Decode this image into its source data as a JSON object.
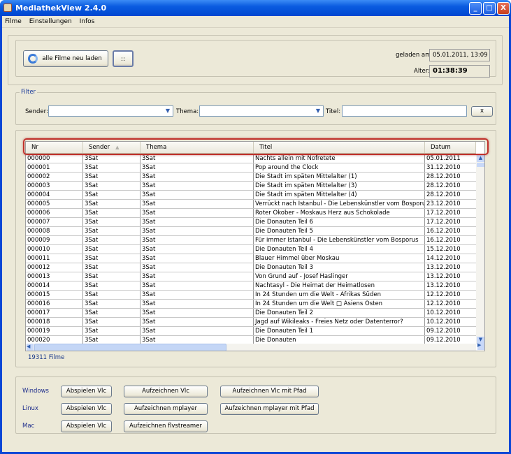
{
  "window": {
    "title": "MediathekView 2.4.0",
    "min": "_",
    "max": "□",
    "close": "X"
  },
  "menu": [
    "Filme",
    "Einstellungen",
    "Infos"
  ],
  "top": {
    "reload_label": "alle Filme neu laden",
    "extra_label": "::",
    "loaded_label": "geladen am:",
    "loaded_value": "05.01.2011, 13:09",
    "age_label": "Alter:",
    "age_value": "01:38:39"
  },
  "filter": {
    "legend": "Filter",
    "sender_label": "Sender:",
    "sender_value": "",
    "thema_label": "Thema:",
    "thema_value": "",
    "titel_label": "Titel:",
    "titel_value": "",
    "clear_label": "x"
  },
  "table": {
    "columns": [
      "Nr",
      "Sender",
      "Thema",
      "Titel",
      "Datum"
    ],
    "sort_column": "Sender",
    "sort_dir": "ascending",
    "rows": [
      [
        "000000",
        "3Sat",
        "3Sat",
        "Nachts allein mit Nofretete",
        "05.01.2011"
      ],
      [
        "000001",
        "3Sat",
        "3Sat",
        "Pop around the Clock",
        "31.12.2010"
      ],
      [
        "000002",
        "3Sat",
        "3Sat",
        "Die Stadt im späten Mittelalter (1)",
        "28.12.2010"
      ],
      [
        "000003",
        "3Sat",
        "3Sat",
        "Die Stadt im späten Mittelalter (3)",
        "28.12.2010"
      ],
      [
        "000004",
        "3Sat",
        "3Sat",
        "Die Stadt im späten Mittelalter (4)",
        "28.12.2010"
      ],
      [
        "000005",
        "3Sat",
        "3Sat",
        "Verrückt nach Istanbul - Die Lebenskünstler vom Bosporus",
        "23.12.2010"
      ],
      [
        "000006",
        "3Sat",
        "3Sat",
        "Roter Okober - Moskaus Herz aus Schokolade",
        "17.12.2010"
      ],
      [
        "000007",
        "3Sat",
        "3Sat",
        "Die Donauten Teil 6",
        "17.12.2010"
      ],
      [
        "000008",
        "3Sat",
        "3Sat",
        "Die Donauten Teil 5",
        "16.12.2010"
      ],
      [
        "000009",
        "3Sat",
        "3Sat",
        "Für immer Istanbul - Die Lebenskünstler vom Bosporus",
        "16.12.2010"
      ],
      [
        "000010",
        "3Sat",
        "3Sat",
        "Die Donauten Teil 4",
        "15.12.2010"
      ],
      [
        "000011",
        "3Sat",
        "3Sat",
        "Blauer Himmel über Moskau",
        "14.12.2010"
      ],
      [
        "000012",
        "3Sat",
        "3Sat",
        "Die Donauten Teil 3",
        "13.12.2010"
      ],
      [
        "000013",
        "3Sat",
        "3Sat",
        "Von Grund auf - Josef Haslinger",
        "13.12.2010"
      ],
      [
        "000014",
        "3Sat",
        "3Sat",
        "Nachtasyl - Die Heimat der Heimatlosen",
        "13.12.2010"
      ],
      [
        "000015",
        "3Sat",
        "3Sat",
        "In 24 Stunden um die Welt - Afrikas Süden",
        "12.12.2010"
      ],
      [
        "000016",
        "3Sat",
        "3Sat",
        "In 24 Stunden um die Welt □ Asiens Osten",
        "12.12.2010"
      ],
      [
        "000017",
        "3Sat",
        "3Sat",
        "Die Donauten Teil 2",
        "10.12.2010"
      ],
      [
        "000018",
        "3Sat",
        "3Sat",
        "Jagd auf Wikileaks - Freies Netz oder Datenterror?",
        "10.12.2010"
      ],
      [
        "000019",
        "3Sat",
        "3Sat",
        "Die Donauten Teil 1",
        "09.12.2010"
      ],
      [
        "000020",
        "3Sat",
        "3Sat",
        "Die Donauten",
        "09.12.2010"
      ]
    ],
    "count_label": "19311 Filme"
  },
  "players": [
    {
      "os": "Windows",
      "buttons": [
        "Abspielen Vlc",
        "Aufzeichnen Vlc",
        "Aufzeichnen Vlc mit Pfad"
      ]
    },
    {
      "os": "Linux",
      "buttons": [
        "Abspielen Vlc",
        "Aufzeichnen mplayer",
        "Aufzeichnen mplayer mit Pfad"
      ]
    },
    {
      "os": "Mac",
      "buttons": [
        "Abspielen Vlc",
        "Aufzeichnen flvstreamer"
      ]
    }
  ]
}
